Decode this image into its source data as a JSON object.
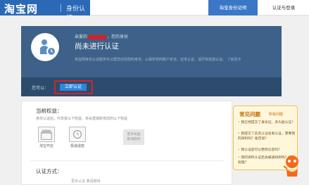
{
  "header": {
    "logo_text": "淘宝网",
    "logo_subtitle": "身份认证",
    "nav_items": [
      "淘宝身份证明",
      "认证与登录"
    ]
  },
  "hero": {
    "greeting_prefix": "亲爱的",
    "greeting_suffix": "，您的身份",
    "status_title": "尚未进行认证",
    "description": "淘宝网身份认证服务可以帮您识别您的身份，以保护您的账户安全。还未认证，请尽快完成认证。",
    "description_link": "了解更多",
    "you_can_label": "您可以：",
    "start_button_label": "立即认证"
  },
  "benefits": {
    "title": "当前权益：",
    "description": "身份认证后，可享受以下权益，将会直接影响您的以下权益",
    "items": [
      {
        "label": "淘宝开店",
        "icon": "shop-icon"
      },
      {
        "label": "极速退款",
        "icon": "refund-icon"
      }
    ],
    "more_label_1": "更多权益",
    "more_label_2": "敬请期待"
  },
  "method": {
    "title": "认证方式：",
    "hint": "更多认证 敬请期待"
  },
  "faq": {
    "title": "常见问题",
    "more_link": "所有问题",
    "questions": [
      "我已经提交了身份证，多久能认证？",
      "我提交了实名认证会发认证，需要我的资料吗？能否退？",
      "我认证后可以更改信息吗？",
      "我的资料认证后会被通知到吗？怎么处理？"
    ]
  },
  "colors": {
    "brand_blue": "#2b69b6",
    "hero_bg": "#3d6188",
    "button_blue": "#2f87d9",
    "highlight_red": "#d2242a",
    "faq_bg": "#fff7dc"
  }
}
